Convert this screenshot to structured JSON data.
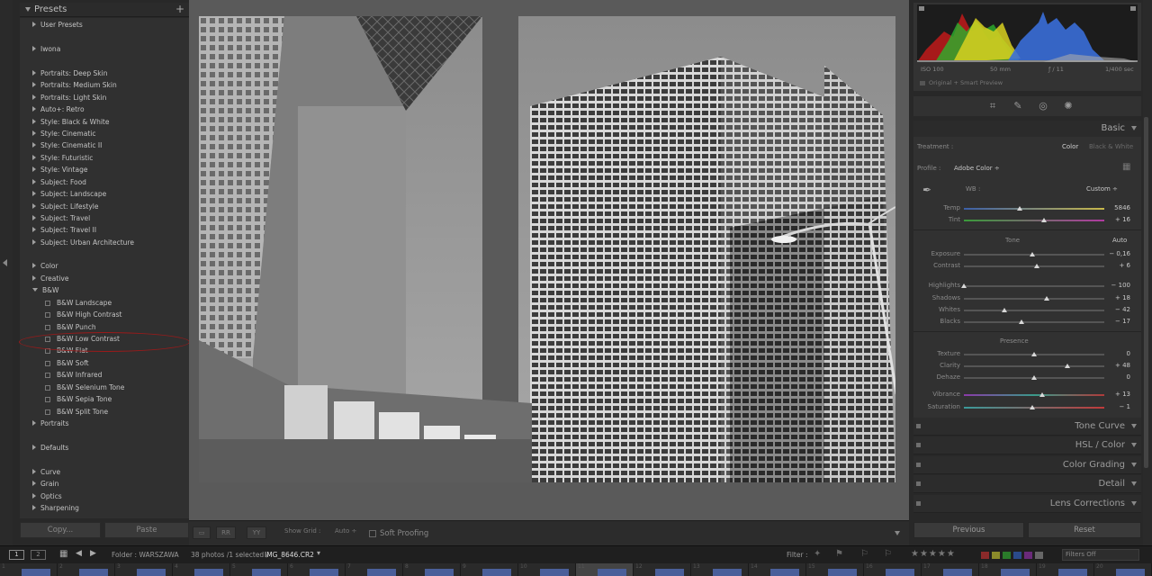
{
  "left_panel": {
    "header": "Presets",
    "items": [
      {
        "label": "User Presets",
        "kind": "group",
        "open": false
      },
      {
        "label": "Iwona",
        "kind": "group",
        "open": false
      },
      {
        "label": "Portraits: Deep Skin",
        "kind": "group",
        "open": false
      },
      {
        "label": "Portraits: Medium Skin",
        "kind": "group",
        "open": false
      },
      {
        "label": "Portraits: Light Skin",
        "kind": "group",
        "open": false
      },
      {
        "label": "Auto+: Retro",
        "kind": "group",
        "open": false
      },
      {
        "label": "Style: Black & White",
        "kind": "group",
        "open": false
      },
      {
        "label": "Style: Cinematic",
        "kind": "group",
        "open": false
      },
      {
        "label": "Style: Cinematic II",
        "kind": "group",
        "open": false
      },
      {
        "label": "Style: Futuristic",
        "kind": "group",
        "open": false
      },
      {
        "label": "Style: Vintage",
        "kind": "group",
        "open": false
      },
      {
        "label": "Subject: Food",
        "kind": "group",
        "open": false
      },
      {
        "label": "Subject: Landscape",
        "kind": "group",
        "open": false
      },
      {
        "label": "Subject: Lifestyle",
        "kind": "group",
        "open": false
      },
      {
        "label": "Subject: Travel",
        "kind": "group",
        "open": false
      },
      {
        "label": "Subject: Travel II",
        "kind": "group",
        "open": false
      },
      {
        "label": "Subject: Urban Architecture",
        "kind": "group",
        "open": false
      },
      {
        "label": "Color",
        "kind": "group",
        "open": false
      },
      {
        "label": "Creative",
        "kind": "group",
        "open": false
      },
      {
        "label": "B&W",
        "kind": "group",
        "open": true
      },
      {
        "label": "B&W Landscape",
        "kind": "preset"
      },
      {
        "label": "B&W High Contrast",
        "kind": "preset"
      },
      {
        "label": "B&W Punch",
        "kind": "preset"
      },
      {
        "label": "B&W Low Contrast",
        "kind": "preset"
      },
      {
        "label": "B&W Flat",
        "kind": "preset"
      },
      {
        "label": "B&W Soft",
        "kind": "preset"
      },
      {
        "label": "B&W Infrared",
        "kind": "preset"
      },
      {
        "label": "B&W Selenium Tone",
        "kind": "preset"
      },
      {
        "label": "B&W Sepia Tone",
        "kind": "preset"
      },
      {
        "label": "B&W Split Tone",
        "kind": "preset"
      },
      {
        "label": "Portraits",
        "kind": "group",
        "open": false
      },
      {
        "label": "Defaults",
        "kind": "group",
        "open": false
      },
      {
        "label": "Curve",
        "kind": "group",
        "open": false
      },
      {
        "label": "Grain",
        "kind": "group",
        "open": false
      },
      {
        "label": "Optics",
        "kind": "group",
        "open": false
      },
      {
        "label": "Sharpening",
        "kind": "group",
        "open": false
      }
    ],
    "copy_label": "Copy...",
    "paste_label": "Paste"
  },
  "toolbar": {
    "show_grid_label": "Show Grid :",
    "auto_label": "Auto ÷",
    "soft_proofing_label": "Soft Proofing"
  },
  "right_panel": {
    "histogram": {
      "iso": "ISO 100",
      "focal": "50 mm",
      "aperture": "ƒ / 11",
      "shutter": "1/400 sec",
      "preview_label": "Original + Smart Preview"
    },
    "basic": {
      "title": "Basic",
      "treatment_label": "Treatment :",
      "treatment_color": "Color",
      "treatment_bw": "Black & White",
      "profile_label": "Profile :",
      "profile_value": "Adobe Color ÷",
      "wb_label": "WB :",
      "wb_value": "Custom ÷",
      "tone_label": "Tone",
      "tone_auto": "Auto",
      "presence_label": "Presence"
    },
    "sliders": [
      {
        "name": "Temp",
        "value": "5846",
        "level": 0.4
      },
      {
        "name": "Tint",
        "value": "+ 16",
        "level": 0.57
      },
      {
        "name": "Exposure",
        "value": "− 0,16",
        "level": 0.49
      },
      {
        "name": "Contrast",
        "value": "+ 6",
        "level": 0.52
      },
      {
        "name": "Highlights",
        "value": "− 100",
        "level": 0.0
      },
      {
        "name": "Shadows",
        "value": "+ 18",
        "level": 0.59
      },
      {
        "name": "Whites",
        "value": "− 42",
        "level": 0.29
      },
      {
        "name": "Blacks",
        "value": "− 17",
        "level": 0.41
      },
      {
        "name": "Texture",
        "value": "0",
        "level": 0.5
      },
      {
        "name": "Clarity",
        "value": "+ 48",
        "level": 0.74
      },
      {
        "name": "Dehaze",
        "value": "0",
        "level": 0.5
      },
      {
        "name": "Vibrance",
        "value": "+ 13",
        "level": 0.56
      },
      {
        "name": "Saturation",
        "value": "− 1",
        "level": 0.49
      }
    ],
    "panels": [
      "Tone Curve",
      "HSL / Color",
      "Color Grading",
      "Detail",
      "Lens Corrections"
    ],
    "previous_label": "Previous",
    "reset_label": "Reset"
  },
  "film_bar": {
    "monitor1": "1",
    "monitor2": "2",
    "folder": "Folder : WARSZAWA",
    "count": "38 photos /1 selected /",
    "filename": "IMG_8646.CR2",
    "filter_label": "Filter :",
    "filters_off": "Filters Off"
  },
  "filmstrip_numbers": [
    "1",
    "2",
    "3",
    "4",
    "5",
    "6",
    "7",
    "8",
    "9",
    "10",
    "11",
    "12",
    "13",
    "14",
    "15",
    "16",
    "17",
    "18",
    "19",
    "20"
  ]
}
